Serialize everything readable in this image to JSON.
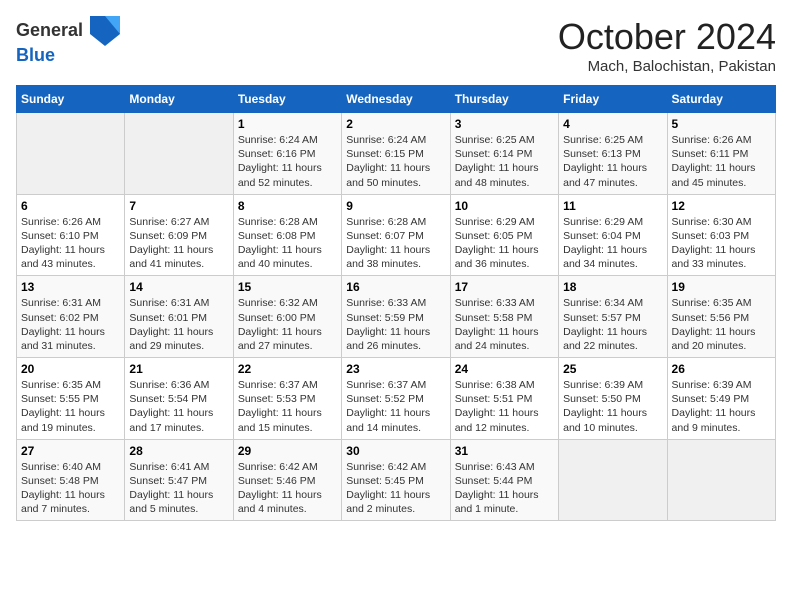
{
  "header": {
    "logo_line1": "General",
    "logo_line2": "Blue",
    "month": "October 2024",
    "location": "Mach, Balochistan, Pakistan"
  },
  "days_of_week": [
    "Sunday",
    "Monday",
    "Tuesday",
    "Wednesday",
    "Thursday",
    "Friday",
    "Saturday"
  ],
  "weeks": [
    [
      {
        "num": "",
        "info": ""
      },
      {
        "num": "",
        "info": ""
      },
      {
        "num": "1",
        "info": "Sunrise: 6:24 AM\nSunset: 6:16 PM\nDaylight: 11 hours and 52 minutes."
      },
      {
        "num": "2",
        "info": "Sunrise: 6:24 AM\nSunset: 6:15 PM\nDaylight: 11 hours and 50 minutes."
      },
      {
        "num": "3",
        "info": "Sunrise: 6:25 AM\nSunset: 6:14 PM\nDaylight: 11 hours and 48 minutes."
      },
      {
        "num": "4",
        "info": "Sunrise: 6:25 AM\nSunset: 6:13 PM\nDaylight: 11 hours and 47 minutes."
      },
      {
        "num": "5",
        "info": "Sunrise: 6:26 AM\nSunset: 6:11 PM\nDaylight: 11 hours and 45 minutes."
      }
    ],
    [
      {
        "num": "6",
        "info": "Sunrise: 6:26 AM\nSunset: 6:10 PM\nDaylight: 11 hours and 43 minutes."
      },
      {
        "num": "7",
        "info": "Sunrise: 6:27 AM\nSunset: 6:09 PM\nDaylight: 11 hours and 41 minutes."
      },
      {
        "num": "8",
        "info": "Sunrise: 6:28 AM\nSunset: 6:08 PM\nDaylight: 11 hours and 40 minutes."
      },
      {
        "num": "9",
        "info": "Sunrise: 6:28 AM\nSunset: 6:07 PM\nDaylight: 11 hours and 38 minutes."
      },
      {
        "num": "10",
        "info": "Sunrise: 6:29 AM\nSunset: 6:05 PM\nDaylight: 11 hours and 36 minutes."
      },
      {
        "num": "11",
        "info": "Sunrise: 6:29 AM\nSunset: 6:04 PM\nDaylight: 11 hours and 34 minutes."
      },
      {
        "num": "12",
        "info": "Sunrise: 6:30 AM\nSunset: 6:03 PM\nDaylight: 11 hours and 33 minutes."
      }
    ],
    [
      {
        "num": "13",
        "info": "Sunrise: 6:31 AM\nSunset: 6:02 PM\nDaylight: 11 hours and 31 minutes."
      },
      {
        "num": "14",
        "info": "Sunrise: 6:31 AM\nSunset: 6:01 PM\nDaylight: 11 hours and 29 minutes."
      },
      {
        "num": "15",
        "info": "Sunrise: 6:32 AM\nSunset: 6:00 PM\nDaylight: 11 hours and 27 minutes."
      },
      {
        "num": "16",
        "info": "Sunrise: 6:33 AM\nSunset: 5:59 PM\nDaylight: 11 hours and 26 minutes."
      },
      {
        "num": "17",
        "info": "Sunrise: 6:33 AM\nSunset: 5:58 PM\nDaylight: 11 hours and 24 minutes."
      },
      {
        "num": "18",
        "info": "Sunrise: 6:34 AM\nSunset: 5:57 PM\nDaylight: 11 hours and 22 minutes."
      },
      {
        "num": "19",
        "info": "Sunrise: 6:35 AM\nSunset: 5:56 PM\nDaylight: 11 hours and 20 minutes."
      }
    ],
    [
      {
        "num": "20",
        "info": "Sunrise: 6:35 AM\nSunset: 5:55 PM\nDaylight: 11 hours and 19 minutes."
      },
      {
        "num": "21",
        "info": "Sunrise: 6:36 AM\nSunset: 5:54 PM\nDaylight: 11 hours and 17 minutes."
      },
      {
        "num": "22",
        "info": "Sunrise: 6:37 AM\nSunset: 5:53 PM\nDaylight: 11 hours and 15 minutes."
      },
      {
        "num": "23",
        "info": "Sunrise: 6:37 AM\nSunset: 5:52 PM\nDaylight: 11 hours and 14 minutes."
      },
      {
        "num": "24",
        "info": "Sunrise: 6:38 AM\nSunset: 5:51 PM\nDaylight: 11 hours and 12 minutes."
      },
      {
        "num": "25",
        "info": "Sunrise: 6:39 AM\nSunset: 5:50 PM\nDaylight: 11 hours and 10 minutes."
      },
      {
        "num": "26",
        "info": "Sunrise: 6:39 AM\nSunset: 5:49 PM\nDaylight: 11 hours and 9 minutes."
      }
    ],
    [
      {
        "num": "27",
        "info": "Sunrise: 6:40 AM\nSunset: 5:48 PM\nDaylight: 11 hours and 7 minutes."
      },
      {
        "num": "28",
        "info": "Sunrise: 6:41 AM\nSunset: 5:47 PM\nDaylight: 11 hours and 5 minutes."
      },
      {
        "num": "29",
        "info": "Sunrise: 6:42 AM\nSunset: 5:46 PM\nDaylight: 11 hours and 4 minutes."
      },
      {
        "num": "30",
        "info": "Sunrise: 6:42 AM\nSunset: 5:45 PM\nDaylight: 11 hours and 2 minutes."
      },
      {
        "num": "31",
        "info": "Sunrise: 6:43 AM\nSunset: 5:44 PM\nDaylight: 11 hours and 1 minute."
      },
      {
        "num": "",
        "info": ""
      },
      {
        "num": "",
        "info": ""
      }
    ]
  ]
}
